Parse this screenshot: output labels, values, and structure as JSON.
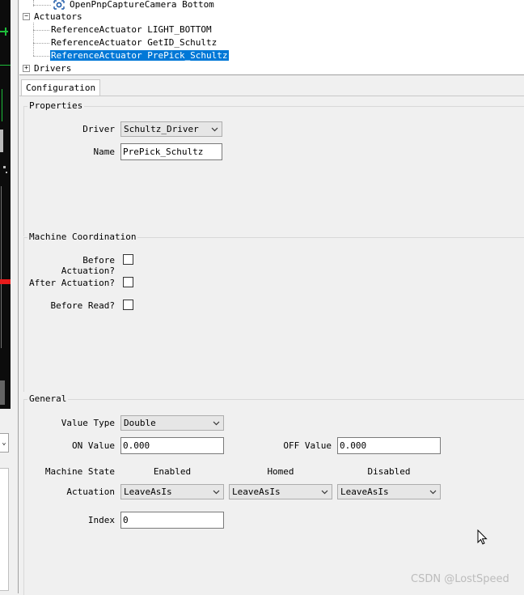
{
  "tree": {
    "camera_item": "OpenPnpCaptureCamera Bottom",
    "actuators_label": "Actuators",
    "actuators": [
      "ReferenceActuator LIGHT_BOTTOM",
      "ReferenceActuator GetID_Schultz",
      "ReferenceActuator PrePick_Schultz"
    ],
    "drivers_label": "Drivers"
  },
  "tabs": {
    "configuration": "Configuration"
  },
  "properties": {
    "title": "Properties",
    "driver_label": "Driver",
    "driver_value": "Schultz_Driver",
    "name_label": "Name",
    "name_value": "PrePick_Schultz"
  },
  "machine_coordination": {
    "title": "Machine Coordination",
    "before_actuation_label": "Before Actuation?",
    "after_actuation_label": "After Actuation?",
    "before_read_label": "Before Read?",
    "before_actuation_checked": false,
    "after_actuation_checked": false,
    "before_read_checked": false
  },
  "general": {
    "title": "General",
    "value_type_label": "Value Type",
    "value_type_value": "Double",
    "on_value_label": "ON Value",
    "on_value": "0.000",
    "off_value_label": "OFF Value",
    "off_value": "0.000",
    "machine_state_label": "Machine State",
    "enabled_label": "Enabled",
    "homed_label": "Homed",
    "disabled_label": "Disabled",
    "actuation_label": "Actuation",
    "actuation_enabled": "LeaveAsIs",
    "actuation_homed": "LeaveAsIs",
    "actuation_disabled": "LeaveAsIs",
    "index_label": "Index",
    "index_value": "0"
  },
  "colors": {
    "selection": "#0078d7",
    "camera_green": "#1dbe3a",
    "camera_red": "#e81b1b"
  },
  "watermark": "CSDN @LostSpeed"
}
